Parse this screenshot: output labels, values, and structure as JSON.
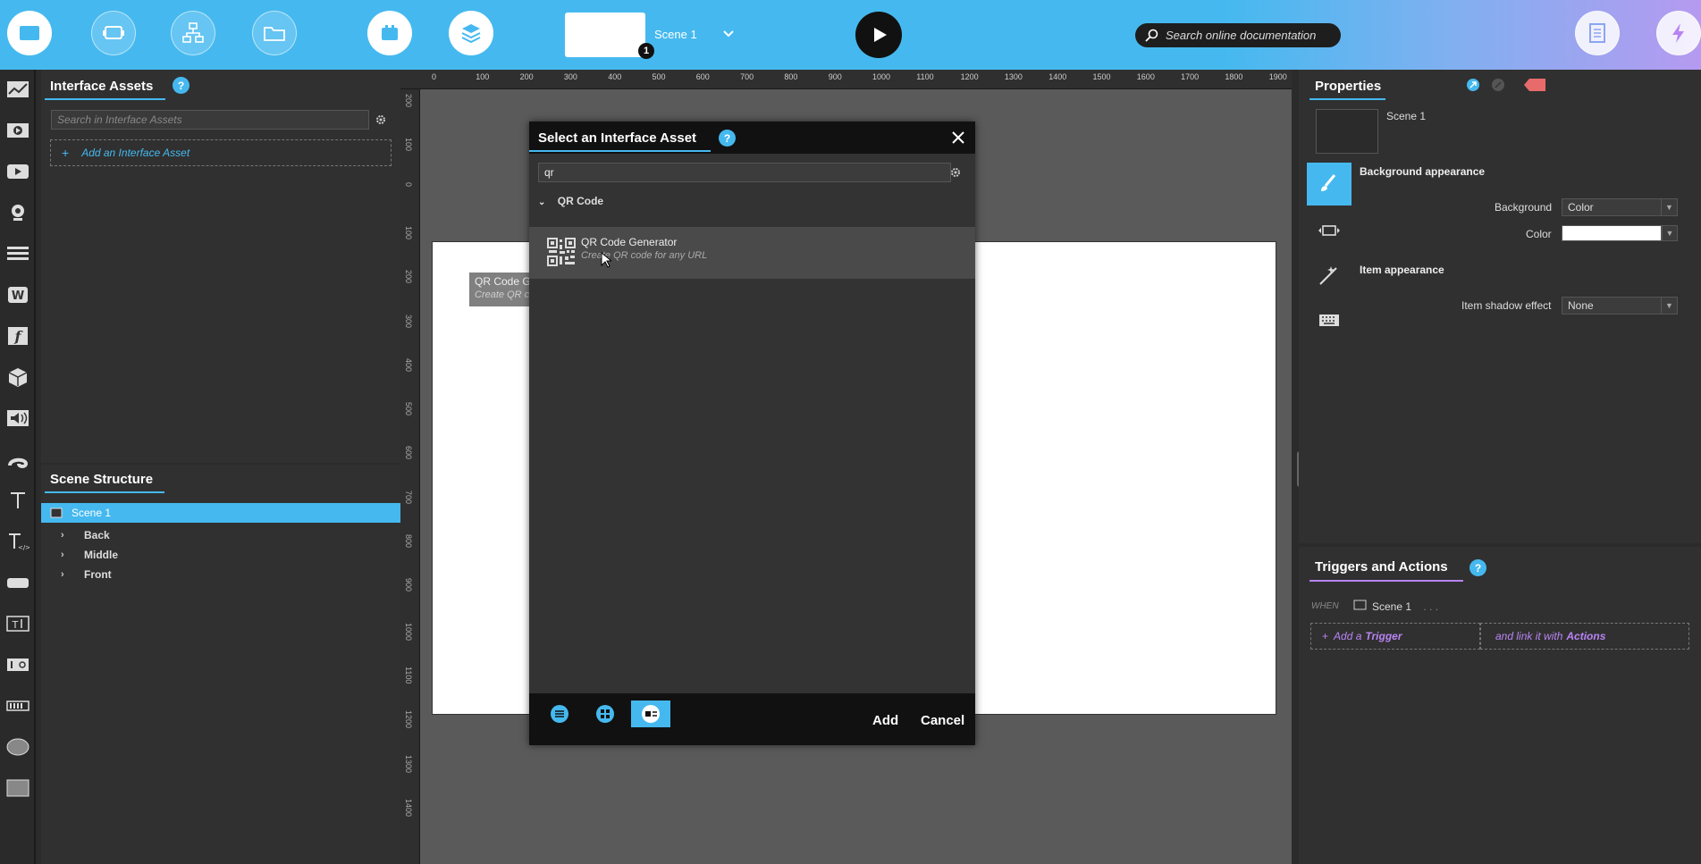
{
  "topbar": {
    "scene_name": "Scene 1",
    "scene_badge": "1",
    "search_placeholder": "Search online documentation"
  },
  "interface_assets": {
    "title": "Interface Assets",
    "help": "?",
    "search_placeholder": "Search in Interface Assets",
    "add_label": "Add an Interface Asset",
    "add_plus": "+"
  },
  "scene_structure": {
    "title": "Scene Structure",
    "items": [
      {
        "label": "Scene 1"
      },
      {
        "label": "Back"
      },
      {
        "label": "Middle"
      },
      {
        "label": "Front"
      }
    ]
  },
  "ruler": {
    "top": [
      "0",
      "100",
      "200",
      "300",
      "400",
      "500",
      "600",
      "700",
      "800",
      "900",
      "1000",
      "1100",
      "1200",
      "1300",
      "1400",
      "1500",
      "1600",
      "1700",
      "1800",
      "1900"
    ],
    "left": [
      "200",
      "100",
      "0",
      "100",
      "200",
      "300",
      "400",
      "500",
      "600",
      "700",
      "800",
      "900",
      "1000",
      "1100",
      "1200",
      "1300",
      "1400"
    ]
  },
  "drag_tooltip": {
    "name": "QR Code Generator",
    "desc": "Create QR code for any URL"
  },
  "dialog": {
    "title": "Select an Interface Asset",
    "help": "?",
    "search_value": "qr",
    "group": "QR Code",
    "item_name": "QR Code Generator",
    "item_desc": "Create QR code for any URL",
    "add": "Add",
    "cancel": "Cancel"
  },
  "properties": {
    "title": "Properties",
    "scene_name": "Scene 1",
    "background_appearance": "Background appearance",
    "background_label": "Background",
    "background_value": "Color",
    "color_label": "Color",
    "item_appearance": "Item appearance",
    "shadow_label": "Item shadow effect",
    "shadow_value": "None"
  },
  "triggers": {
    "title": "Triggers and Actions",
    "help": "?",
    "when": "WHEN",
    "scene": "Scene 1",
    "ellipsis": ". . .",
    "add_prefix": "Add a",
    "add_bold": "Trigger",
    "link_prefix": "and link it with",
    "link_bold": "Actions"
  },
  "colors": {
    "accent": "#45b9ef",
    "trigger_purple": "#b884f4",
    "panel": "#303030"
  }
}
